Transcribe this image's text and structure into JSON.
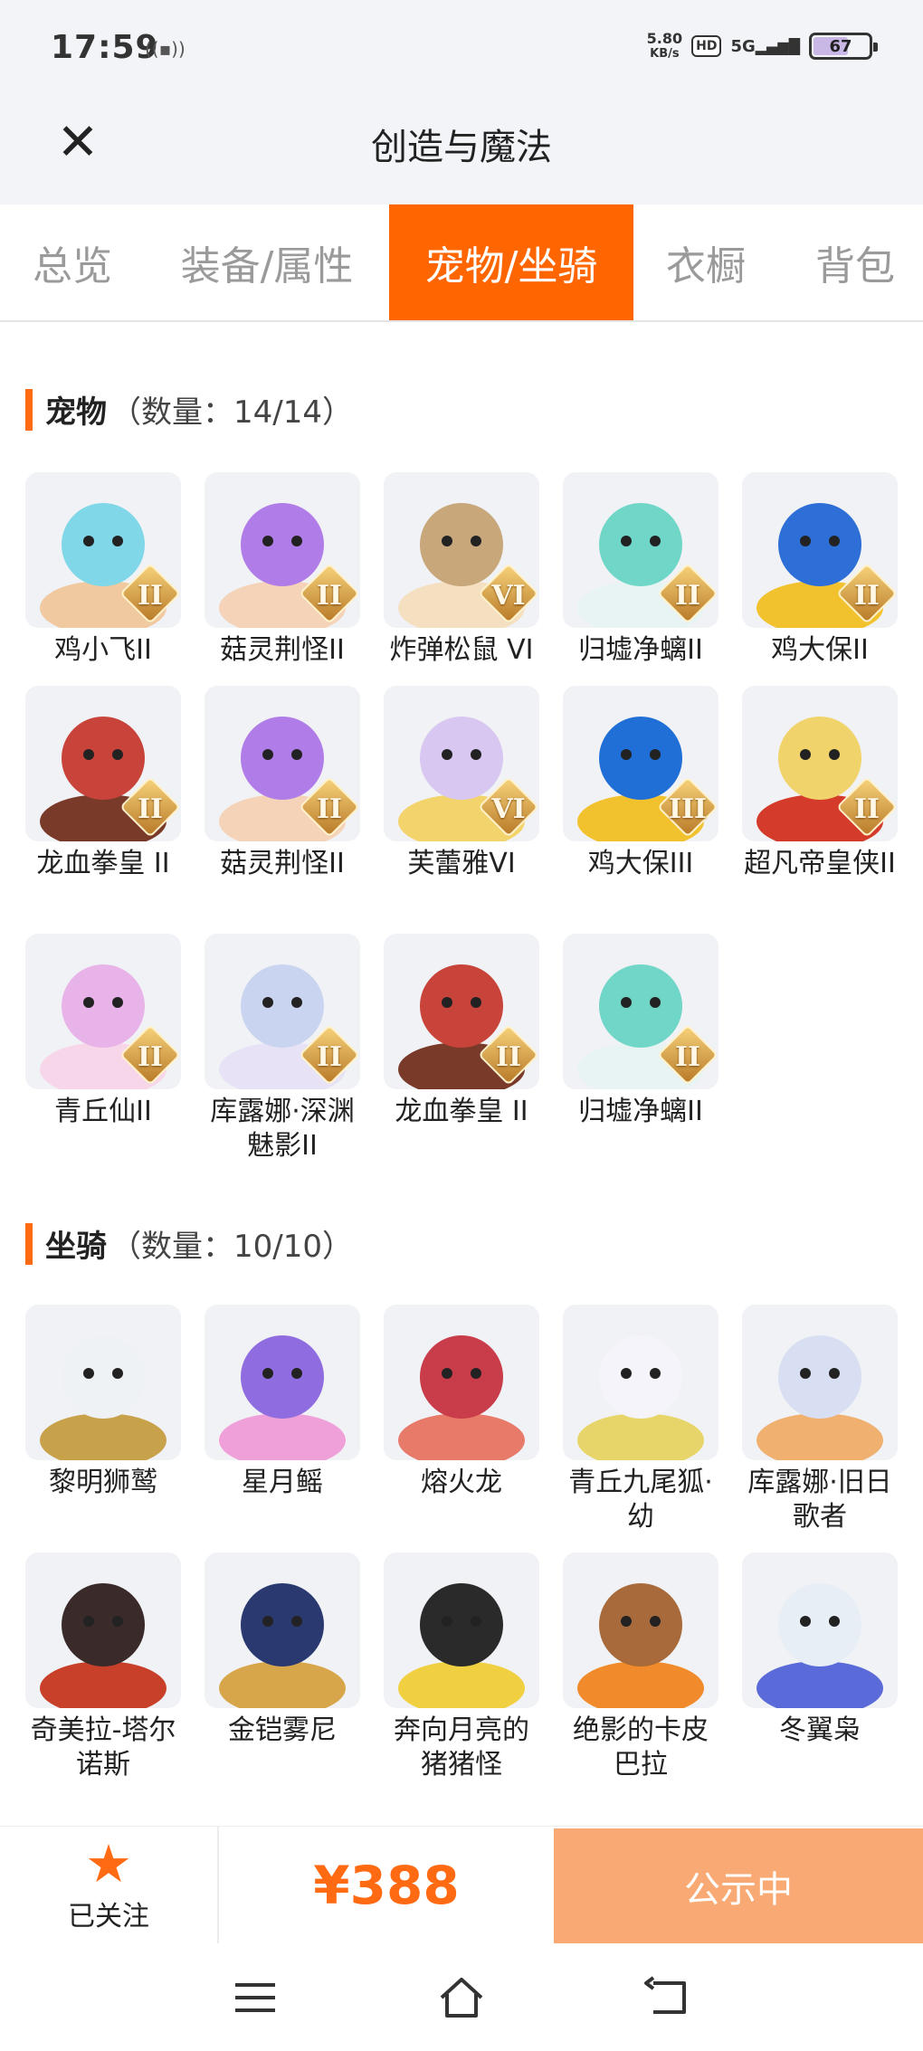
{
  "status_bar": {
    "time": "17:59",
    "vibrate_icon": "vibrate-icon",
    "speed_value": "5.80",
    "speed_unit": "KB/s",
    "hd": "HD",
    "network": "5G",
    "battery": "67"
  },
  "header": {
    "title": "创造与魔法",
    "close_icon": "close-icon"
  },
  "tabs": [
    {
      "label": "总览",
      "active": false
    },
    {
      "label": "装备/属性",
      "active": false
    },
    {
      "label": "宠物/坐骑",
      "active": true
    },
    {
      "label": "衣橱",
      "active": false
    },
    {
      "label": "背包",
      "active": false
    }
  ],
  "pets": {
    "title": "宠物",
    "count": "（数量：14/14）",
    "items": [
      {
        "label": "鸡小飞II",
        "badge": "II"
      },
      {
        "label": "菇灵荆怪II",
        "badge": "II"
      },
      {
        "label": "炸弹松鼠 VI",
        "badge": "VI"
      },
      {
        "label": "归墟净螭II",
        "badge": "II"
      },
      {
        "label": "鸡大保II",
        "badge": "II"
      },
      {
        "label": "龙血拳皇 II",
        "badge": "II"
      },
      {
        "label": "菇灵荆怪II",
        "badge": "II"
      },
      {
        "label": "芙蕾雅VI",
        "badge": "VI"
      },
      {
        "label": "鸡大保III",
        "badge": "III"
      },
      {
        "label": "超凡帝皇侠II",
        "badge": "II"
      },
      {
        "label": "青丘仙II",
        "badge": "II"
      },
      {
        "label": "库露娜·深渊魅影II",
        "badge": "II"
      },
      {
        "label": "龙血拳皇 II",
        "badge": "II"
      },
      {
        "label": "归墟净螭II",
        "badge": "II"
      }
    ]
  },
  "mounts": {
    "title": "坐骑",
    "count": "（数量：10/10）",
    "items": [
      {
        "label": "黎明狮鹫"
      },
      {
        "label": "星月鳐"
      },
      {
        "label": "熔火龙"
      },
      {
        "label": "青丘九尾狐·幼"
      },
      {
        "label": "库露娜·旧日歌者"
      },
      {
        "label": "奇美拉-塔尔诺斯"
      },
      {
        "label": "金铠雾尼"
      },
      {
        "label": "奔向月亮的猪猪怪"
      },
      {
        "label": "绝影的卡皮巴拉"
      },
      {
        "label": "冬翼枭"
      }
    ]
  },
  "bottom": {
    "follow_label": "已关注",
    "follow_icon": "star-icon",
    "price": "¥388",
    "status_label": "公示中"
  },
  "nav": {
    "menu_icon": "menu-icon",
    "home_icon": "home-icon",
    "back_icon": "back-icon"
  },
  "colors": {
    "accent": "#ff6600",
    "price": "#ff6a13",
    "status_button": "#f9a973",
    "header_bg": "#f2f4f7"
  }
}
